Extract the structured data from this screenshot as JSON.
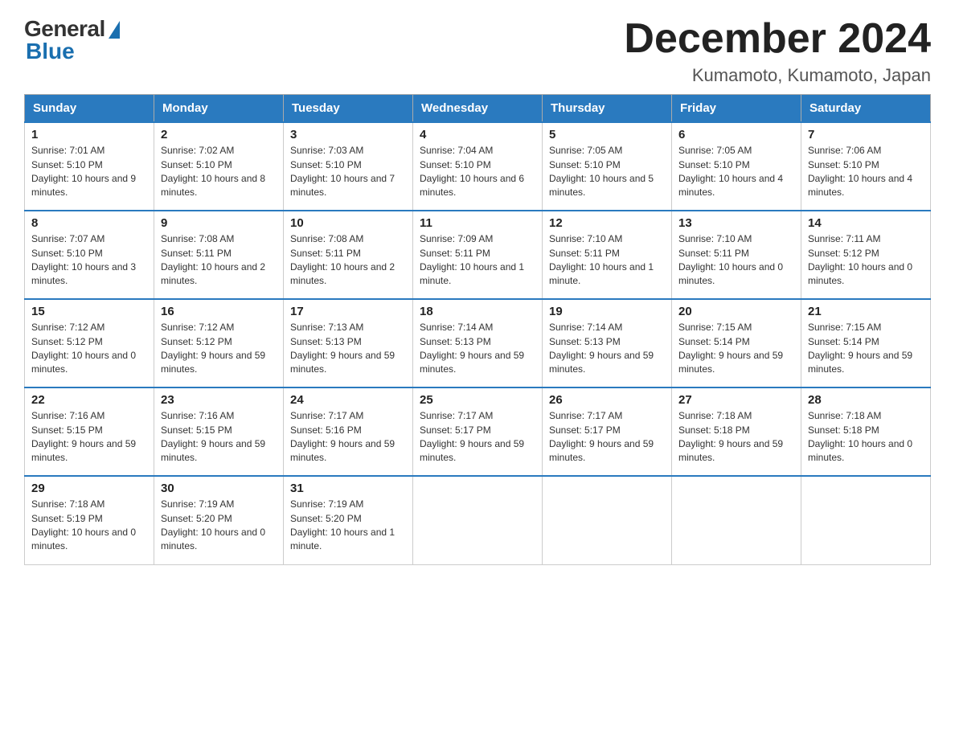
{
  "header": {
    "logo_general": "General",
    "logo_blue": "Blue",
    "month_title": "December 2024",
    "location": "Kumamoto, Kumamoto, Japan"
  },
  "days_of_week": [
    "Sunday",
    "Monday",
    "Tuesday",
    "Wednesday",
    "Thursday",
    "Friday",
    "Saturday"
  ],
  "weeks": [
    [
      {
        "day": "1",
        "sunrise": "7:01 AM",
        "sunset": "5:10 PM",
        "daylight": "10 hours and 9 minutes."
      },
      {
        "day": "2",
        "sunrise": "7:02 AM",
        "sunset": "5:10 PM",
        "daylight": "10 hours and 8 minutes."
      },
      {
        "day": "3",
        "sunrise": "7:03 AM",
        "sunset": "5:10 PM",
        "daylight": "10 hours and 7 minutes."
      },
      {
        "day": "4",
        "sunrise": "7:04 AM",
        "sunset": "5:10 PM",
        "daylight": "10 hours and 6 minutes."
      },
      {
        "day": "5",
        "sunrise": "7:05 AM",
        "sunset": "5:10 PM",
        "daylight": "10 hours and 5 minutes."
      },
      {
        "day": "6",
        "sunrise": "7:05 AM",
        "sunset": "5:10 PM",
        "daylight": "10 hours and 4 minutes."
      },
      {
        "day": "7",
        "sunrise": "7:06 AM",
        "sunset": "5:10 PM",
        "daylight": "10 hours and 4 minutes."
      }
    ],
    [
      {
        "day": "8",
        "sunrise": "7:07 AM",
        "sunset": "5:10 PM",
        "daylight": "10 hours and 3 minutes."
      },
      {
        "day": "9",
        "sunrise": "7:08 AM",
        "sunset": "5:11 PM",
        "daylight": "10 hours and 2 minutes."
      },
      {
        "day": "10",
        "sunrise": "7:08 AM",
        "sunset": "5:11 PM",
        "daylight": "10 hours and 2 minutes."
      },
      {
        "day": "11",
        "sunrise": "7:09 AM",
        "sunset": "5:11 PM",
        "daylight": "10 hours and 1 minute."
      },
      {
        "day": "12",
        "sunrise": "7:10 AM",
        "sunset": "5:11 PM",
        "daylight": "10 hours and 1 minute."
      },
      {
        "day": "13",
        "sunrise": "7:10 AM",
        "sunset": "5:11 PM",
        "daylight": "10 hours and 0 minutes."
      },
      {
        "day": "14",
        "sunrise": "7:11 AM",
        "sunset": "5:12 PM",
        "daylight": "10 hours and 0 minutes."
      }
    ],
    [
      {
        "day": "15",
        "sunrise": "7:12 AM",
        "sunset": "5:12 PM",
        "daylight": "10 hours and 0 minutes."
      },
      {
        "day": "16",
        "sunrise": "7:12 AM",
        "sunset": "5:12 PM",
        "daylight": "9 hours and 59 minutes."
      },
      {
        "day": "17",
        "sunrise": "7:13 AM",
        "sunset": "5:13 PM",
        "daylight": "9 hours and 59 minutes."
      },
      {
        "day": "18",
        "sunrise": "7:14 AM",
        "sunset": "5:13 PM",
        "daylight": "9 hours and 59 minutes."
      },
      {
        "day": "19",
        "sunrise": "7:14 AM",
        "sunset": "5:13 PM",
        "daylight": "9 hours and 59 minutes."
      },
      {
        "day": "20",
        "sunrise": "7:15 AM",
        "sunset": "5:14 PM",
        "daylight": "9 hours and 59 minutes."
      },
      {
        "day": "21",
        "sunrise": "7:15 AM",
        "sunset": "5:14 PM",
        "daylight": "9 hours and 59 minutes."
      }
    ],
    [
      {
        "day": "22",
        "sunrise": "7:16 AM",
        "sunset": "5:15 PM",
        "daylight": "9 hours and 59 minutes."
      },
      {
        "day": "23",
        "sunrise": "7:16 AM",
        "sunset": "5:15 PM",
        "daylight": "9 hours and 59 minutes."
      },
      {
        "day": "24",
        "sunrise": "7:17 AM",
        "sunset": "5:16 PM",
        "daylight": "9 hours and 59 minutes."
      },
      {
        "day": "25",
        "sunrise": "7:17 AM",
        "sunset": "5:17 PM",
        "daylight": "9 hours and 59 minutes."
      },
      {
        "day": "26",
        "sunrise": "7:17 AM",
        "sunset": "5:17 PM",
        "daylight": "9 hours and 59 minutes."
      },
      {
        "day": "27",
        "sunrise": "7:18 AM",
        "sunset": "5:18 PM",
        "daylight": "9 hours and 59 minutes."
      },
      {
        "day": "28",
        "sunrise": "7:18 AM",
        "sunset": "5:18 PM",
        "daylight": "10 hours and 0 minutes."
      }
    ],
    [
      {
        "day": "29",
        "sunrise": "7:18 AM",
        "sunset": "5:19 PM",
        "daylight": "10 hours and 0 minutes."
      },
      {
        "day": "30",
        "sunrise": "7:19 AM",
        "sunset": "5:20 PM",
        "daylight": "10 hours and 0 minutes."
      },
      {
        "day": "31",
        "sunrise": "7:19 AM",
        "sunset": "5:20 PM",
        "daylight": "10 hours and 1 minute."
      },
      null,
      null,
      null,
      null
    ]
  ]
}
